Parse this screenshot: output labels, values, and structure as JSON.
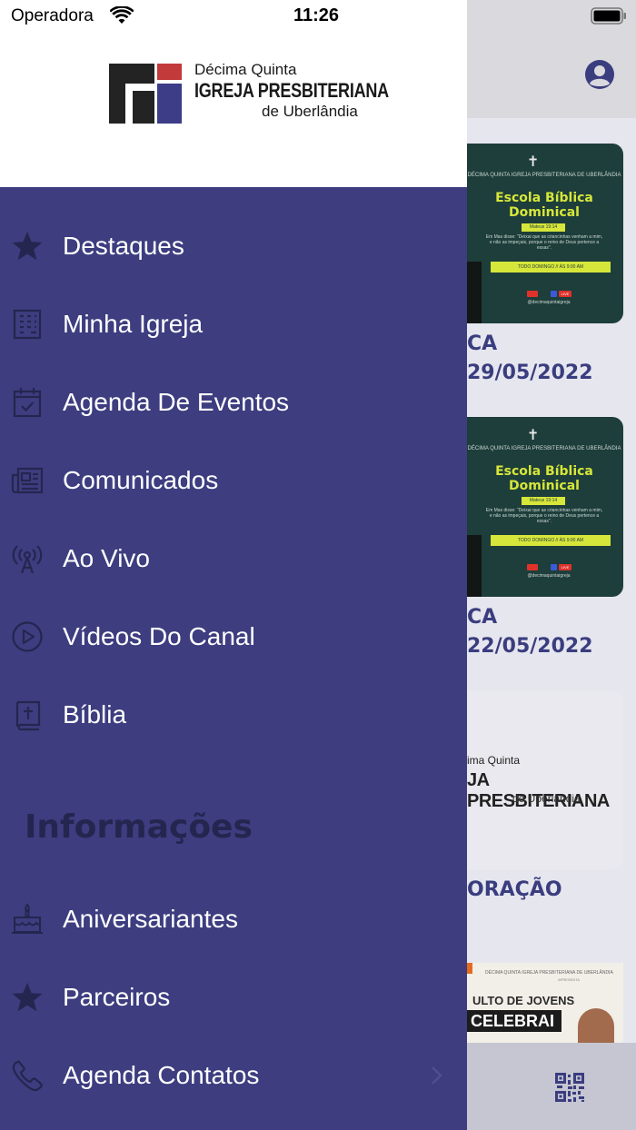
{
  "status_bar": {
    "carrier": "Operadora",
    "time": "11:26",
    "wifi_icon": "wifi-icon",
    "battery_icon": "battery-icon"
  },
  "logo": {
    "line1": "Décima Quinta",
    "line2": "IGREJA PRESBITERIANA",
    "line3": "de Uberlândia",
    "colors": {
      "dark": "#232323",
      "red": "#c23a3a",
      "blue": "#3c3c87"
    }
  },
  "menu": {
    "items": [
      {
        "label": "Destaques",
        "icon": "star-icon"
      },
      {
        "label": "Minha Igreja",
        "icon": "building-icon"
      },
      {
        "label": "Agenda De Eventos",
        "icon": "calendar-check-icon"
      },
      {
        "label": "Comunicados",
        "icon": "newspaper-icon"
      },
      {
        "label": "Ao Vivo",
        "icon": "broadcast-icon"
      },
      {
        "label": "Vídeos Do Canal",
        "icon": "play-circle-icon"
      },
      {
        "label": "Bíblia",
        "icon": "bible-icon"
      }
    ],
    "section_title": "Informações",
    "info_items": [
      {
        "label": "Aniversariantes",
        "icon": "birthday-cake-icon"
      },
      {
        "label": "Parceiros",
        "icon": "star-icon"
      },
      {
        "label": "Agenda Contatos",
        "icon": "phone-icon"
      }
    ]
  },
  "background": {
    "cards": [
      {
        "church": "DÉCIMA QUINTA IGREJA PRESBITERIANA DE UBERLÂNDIA",
        "title_line1": "Escola Bíblica",
        "title_line2": "Dominical",
        "verse_ref": "Mateus 19:14",
        "verse": "Em Mas disse: \"Deixai que as criancinhas venham a mim, e não as impeçais, porque o reino de Deus pertence a essas\".",
        "schedule": "TODO DOMINGO // ÀS 9:00 AM",
        "live": "LIVE",
        "handle": "@decimaquintaigreja",
        "label_line1": "CA",
        "label_line2": "29/05/2022"
      },
      {
        "church": "DÉCIMA QUINTA IGREJA PRESBITERIANA DE UBERLÂNDIA",
        "title_line1": "Escola Bíblica",
        "title_line2": "Dominical",
        "verse_ref": "Mateus 19:14",
        "verse": "Em Mas disse: \"Deixai que as criancinhas venham a mim, e não as impeçais, porque o reino de Deus pertence a essas\".",
        "schedule": "TODO DOMINGO // ÀS 9:00 AM",
        "live": "LIVE",
        "handle": "@decimaquintaigreja",
        "label_line1": "CA",
        "label_line2": "22/05/2022"
      }
    ],
    "logo_card": {
      "l1": "ima Quinta",
      "l2": "JA PRESBITERIANA",
      "l3": "de Uberlândia",
      "label": "ORAÇÃO"
    },
    "jovens_card": {
      "top": "DÉCIMA QUINTA IGREJA PRESBITERIANA DE UBERLÂNDIA",
      "top2": "APRESENTA",
      "culto": "ULTO DE JOVENS",
      "celebra": "CELEBRAI"
    },
    "avatar_icon": "user-circle-icon",
    "qr_icon": "qr-code-icon"
  }
}
